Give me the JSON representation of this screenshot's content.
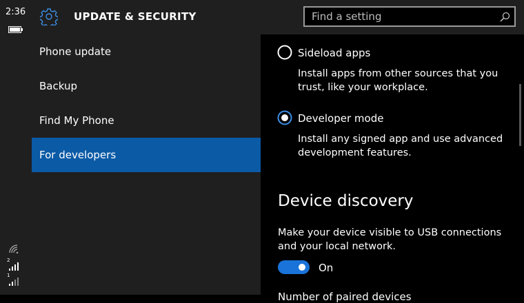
{
  "status": {
    "time": "2:36",
    "sim1": "2",
    "sim2": "1"
  },
  "header": {
    "title": "UPDATE & SECURITY",
    "search_placeholder": "Find a setting"
  },
  "nav": {
    "items": [
      {
        "label": "Phone update",
        "active": false
      },
      {
        "label": "Backup",
        "active": false
      },
      {
        "label": "Find My Phone",
        "active": false
      },
      {
        "label": "For developers",
        "active": true
      }
    ]
  },
  "content": {
    "options": [
      {
        "label": "Sideload apps",
        "description": "Install apps from other sources that you trust, like your workplace.",
        "selected": false
      },
      {
        "label": "Developer mode",
        "description": "Install any signed app and use advanced development features.",
        "selected": true
      }
    ],
    "section_title": "Device discovery",
    "section_text": "Make your device visible to USB connections and your local network.",
    "toggle_state": "On",
    "next_text_partial": "Number of paired devices"
  },
  "colors": {
    "accent": "#1a73d9",
    "selected_nav": "#0b5aa6",
    "panel": "#1f1f1f"
  }
}
